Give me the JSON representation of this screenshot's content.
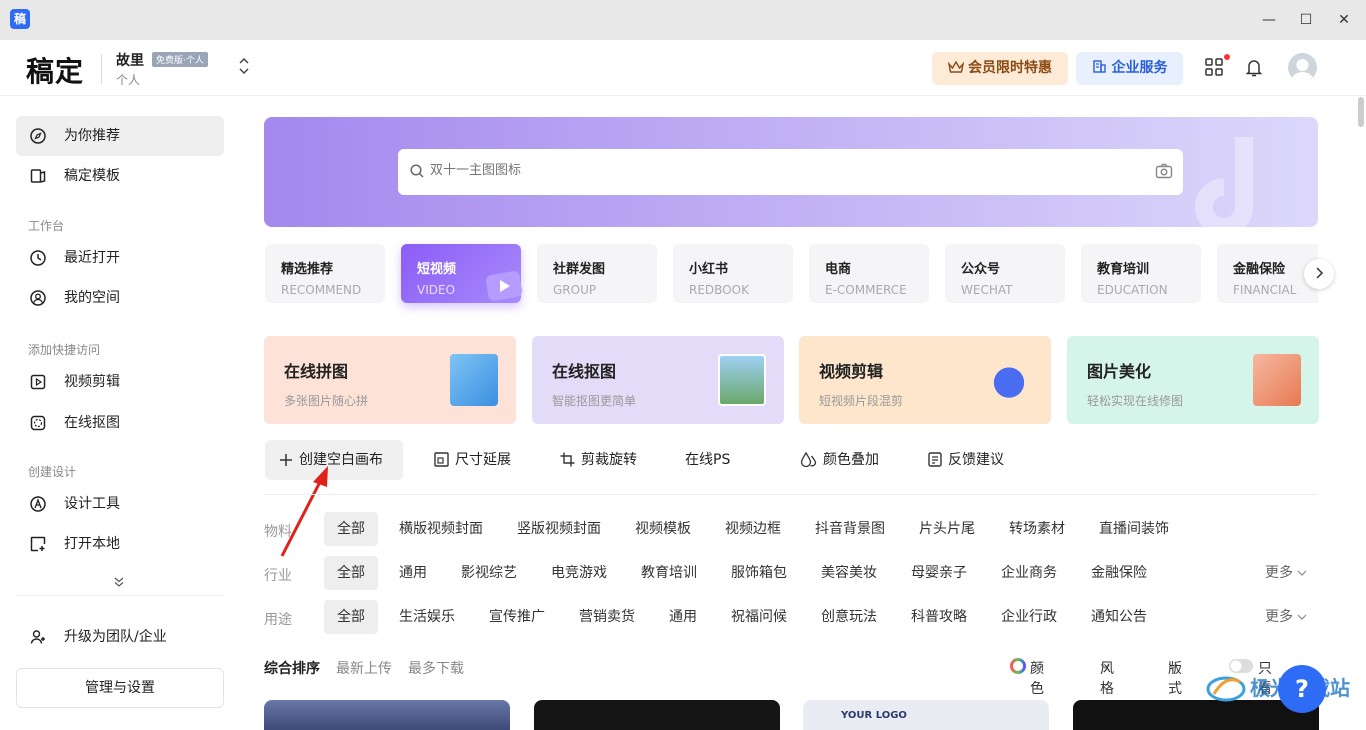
{
  "window": {
    "icon_text": "稿",
    "min": "—",
    "max": "☐",
    "close": "✕"
  },
  "header": {
    "logo": "稿定",
    "user_name": "故里",
    "user_badge": "免费版·个人",
    "user_sub": "个人",
    "vip_button": "会员限时特惠",
    "enterprise_button": "企业服务"
  },
  "sidebar": {
    "items": [
      {
        "label": "为你推荐",
        "icon": "compass-icon"
      },
      {
        "label": "稿定模板",
        "icon": "template-icon"
      }
    ],
    "workspace_group": "工作台",
    "workspace_items": [
      {
        "label": "最近打开",
        "icon": "clock-icon"
      },
      {
        "label": "我的空间",
        "icon": "user-circle-icon"
      }
    ],
    "quick_group": "添加快捷访问",
    "quick_items": [
      {
        "label": "视频剪辑",
        "icon": "video-icon"
      },
      {
        "label": "在线抠图",
        "icon": "cutout-icon"
      }
    ],
    "create_group": "创建设计",
    "create_items": [
      {
        "label": "设计工具",
        "icon": "design-tool-icon"
      },
      {
        "label": "打开本地",
        "icon": "open-local-icon"
      }
    ],
    "upgrade": "升级为团队/企业",
    "manage": "管理与设置"
  },
  "search": {
    "placeholder": "双十一主图图标"
  },
  "categories": [
    {
      "name": "精选推荐",
      "en": "RECOMMEND"
    },
    {
      "name": "短视频",
      "en": "VIDEO"
    },
    {
      "name": "社群发图",
      "en": "GROUP"
    },
    {
      "name": "小红书",
      "en": "REDBOOK"
    },
    {
      "name": "电商",
      "en": "E-COMMERCE"
    },
    {
      "name": "公众号",
      "en": "WECHAT"
    },
    {
      "name": "教育培训",
      "en": "EDUCATION"
    },
    {
      "name": "金融保险",
      "en": "FINANCIAL"
    }
  ],
  "tools": [
    {
      "title": "在线拼图",
      "sub": "多张图片随心拼",
      "bg": "#fde2d8"
    },
    {
      "title": "在线抠图",
      "sub": "智能抠图更简单",
      "bg": "#e3dcf8"
    },
    {
      "title": "视频剪辑",
      "sub": "短视频片段混剪",
      "bg": "#fde6cc"
    },
    {
      "title": "图片美化",
      "sub": "轻松实现在线修图",
      "bg": "#d6f5ea"
    }
  ],
  "quick_actions": [
    "创建空白画布",
    "尺寸延展",
    "剪裁旋转",
    "在线PS",
    "颜色叠加",
    "反馈建议"
  ],
  "filters": {
    "material": {
      "label": "物料",
      "all": "全部",
      "chips": [
        "横版视频封面",
        "竖版视频封面",
        "视频模板",
        "视频边框",
        "抖音背景图",
        "片头片尾",
        "转场素材",
        "直播间装饰"
      ]
    },
    "industry": {
      "label": "行业",
      "all": "全部",
      "chips": [
        "通用",
        "影视综艺",
        "电竞游戏",
        "教育培训",
        "服饰箱包",
        "美容美妆",
        "母婴亲子",
        "企业商务",
        "金融保险"
      ],
      "more": "更多"
    },
    "usage": {
      "label": "用途",
      "all": "全部",
      "chips": [
        "生活娱乐",
        "宣传推广",
        "营销卖货",
        "通用",
        "祝福问候",
        "创意玩法",
        "科普攻略",
        "企业行政",
        "通知公告"
      ],
      "more": "更多"
    }
  },
  "sort": {
    "tabs": [
      "综合排序",
      "最新上传",
      "最多下载"
    ],
    "color": "颜色",
    "style": "风格",
    "format": "版式",
    "only": "只看"
  },
  "cards": [
    {
      "bg": "#4a5a8a"
    },
    {
      "bg": "#1a1a1a",
      "text": ""
    },
    {
      "bg": "#e9edf3",
      "text": "YOUR LOGO"
    },
    {
      "bg": "#111"
    }
  ],
  "help": "?",
  "watermark": "极光下载站"
}
